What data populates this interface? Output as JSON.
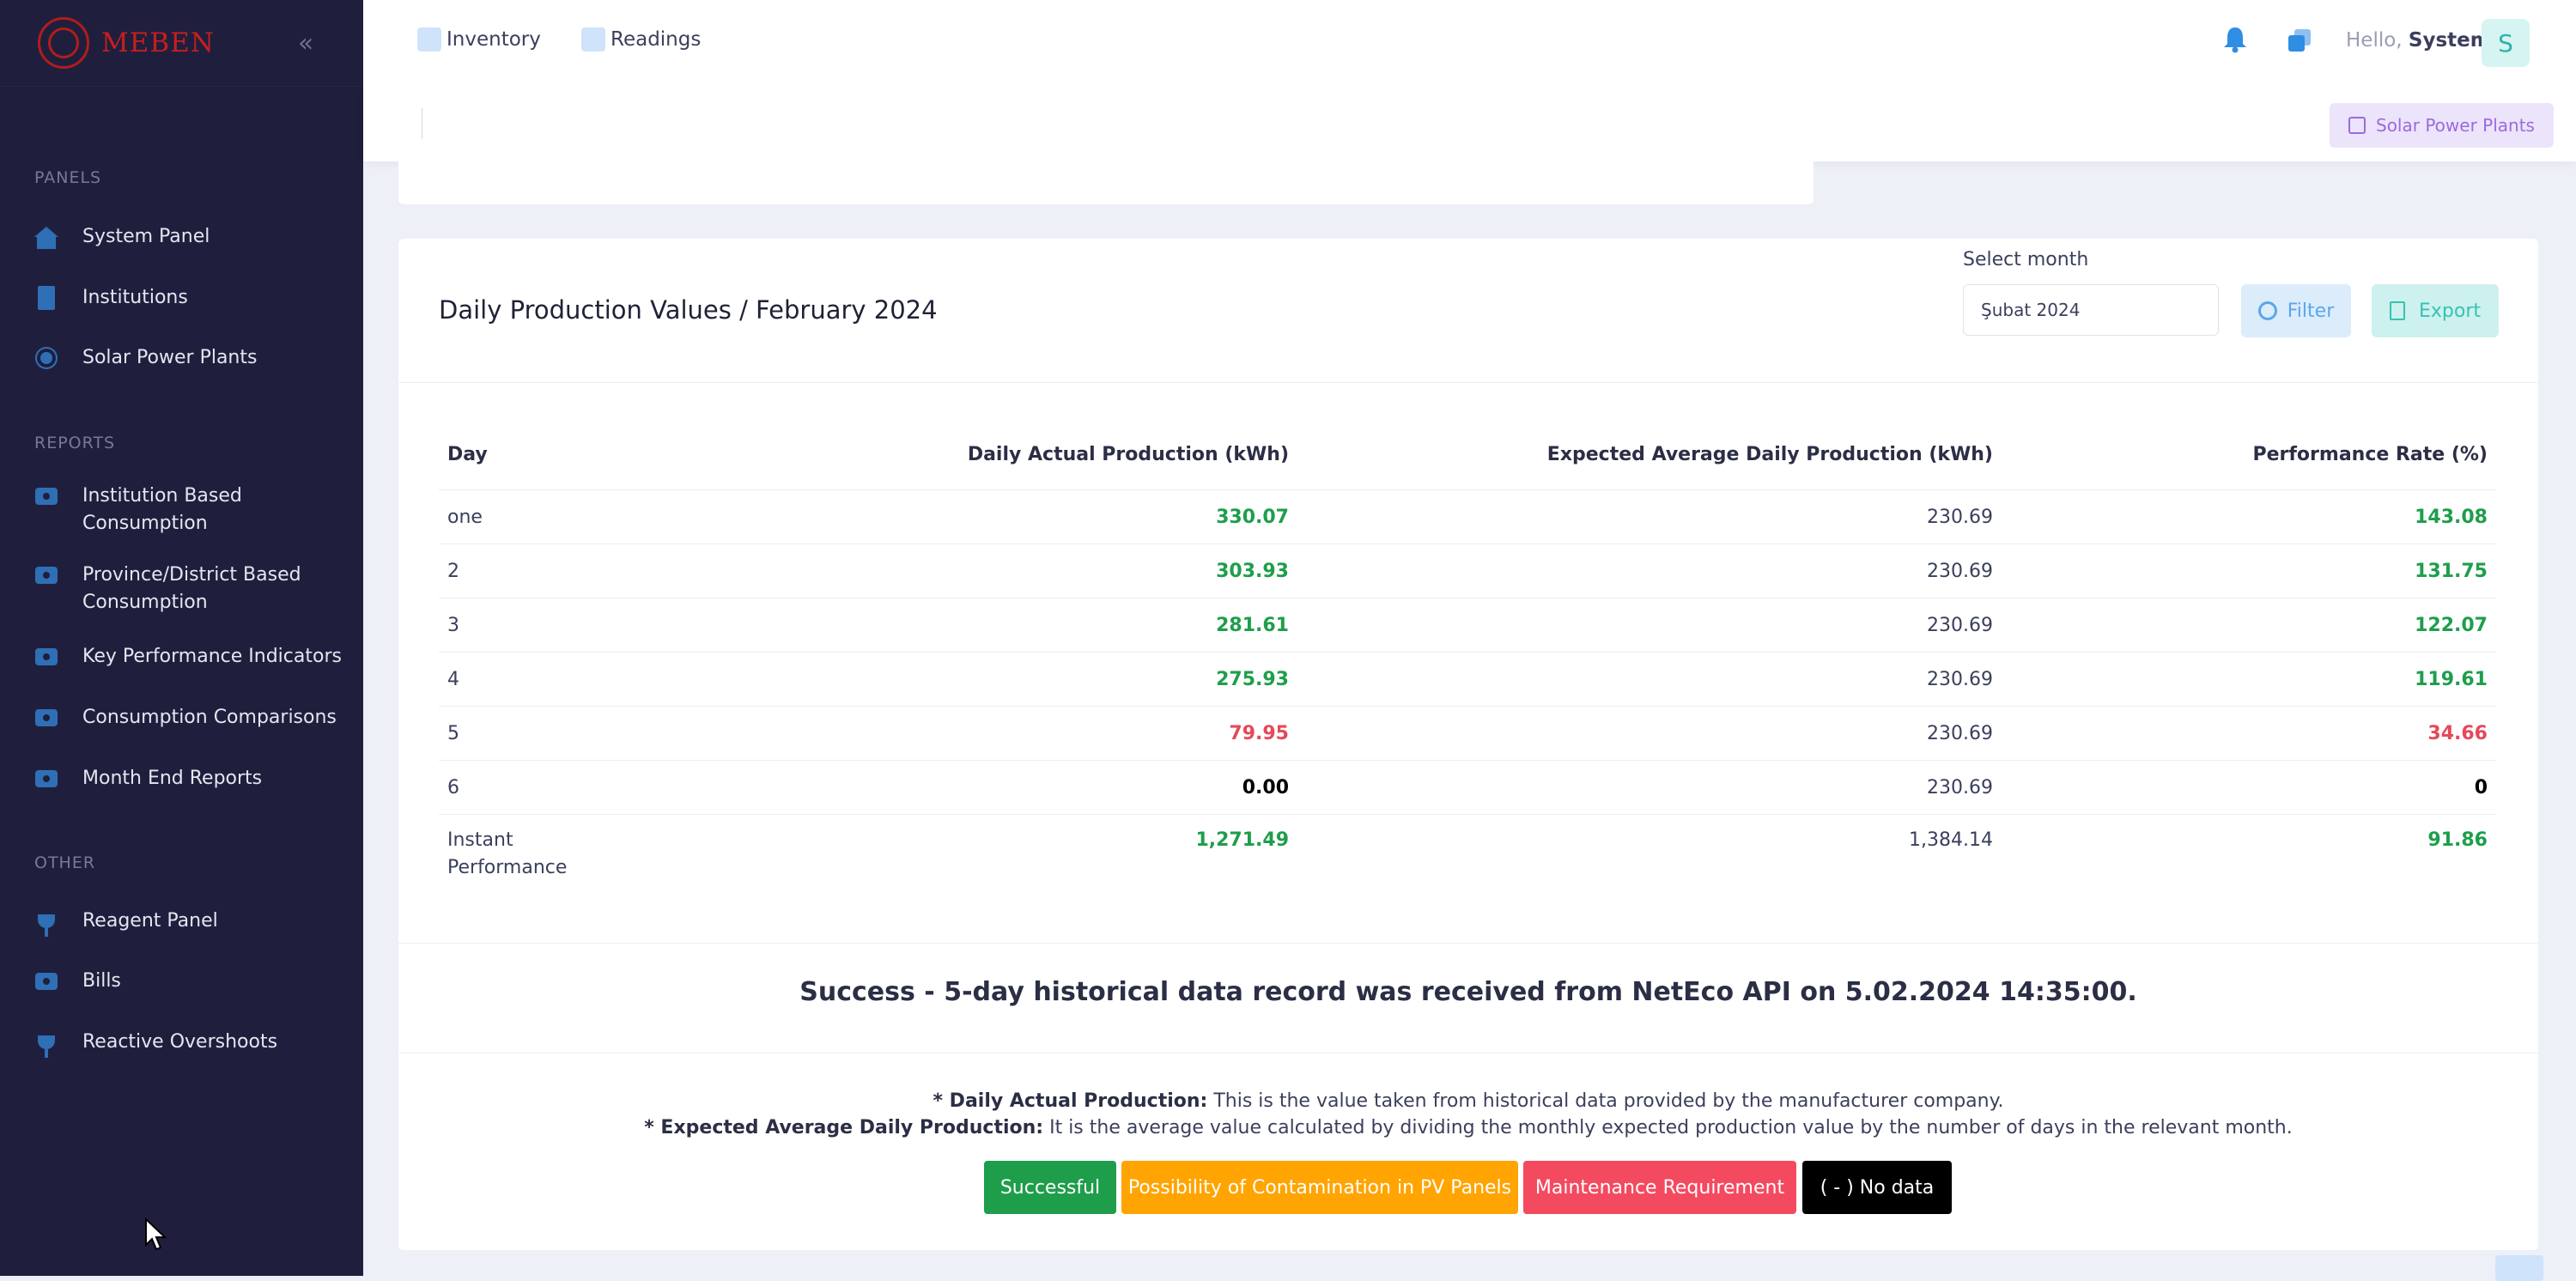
{
  "brand": {
    "name": "MEBEN"
  },
  "sidebar": {
    "sections": [
      {
        "title": "PANELS",
        "items": [
          {
            "label": "System Panel",
            "icon": "house-icon"
          },
          {
            "label": "Institutions",
            "icon": "building-icon"
          },
          {
            "label": "Solar Power Plants",
            "icon": "sun-icon"
          }
        ]
      },
      {
        "title": "REPORTS",
        "items": [
          {
            "label": "Institution Based Consumption",
            "icon": "report-icon"
          },
          {
            "label": "Province/District Based Consumption",
            "icon": "report-icon"
          },
          {
            "label": "Key Performance Indicators",
            "icon": "report-icon"
          },
          {
            "label": "Consumption Comparisons",
            "icon": "report-icon"
          },
          {
            "label": "Month End Reports",
            "icon": "report-icon"
          }
        ]
      },
      {
        "title": "OTHER",
        "items": [
          {
            "label": "Reagent Panel",
            "icon": "plug-icon"
          },
          {
            "label": "Bills",
            "icon": "report-icon"
          },
          {
            "label": "Reactive Overshoots",
            "icon": "plug-icon"
          }
        ]
      }
    ]
  },
  "topbar": {
    "links": [
      {
        "label": "Inventory"
      },
      {
        "label": "Readings"
      }
    ],
    "greeting": "Hello,",
    "user": "System",
    "avatar_letter": "S"
  },
  "subbar": {
    "button_label": "Solar Power Plants"
  },
  "card": {
    "title": "Daily Production Values / February 2024",
    "select_month_label": "Select month",
    "month_value": "Şubat 2024",
    "filter_label": "Filter",
    "export_label": "Export",
    "columns": [
      "Day",
      "Daily Actual Production (kWh)",
      "Expected Average Daily Production (kWh)",
      "Performance Rate (%)"
    ],
    "rows": [
      {
        "day": "one",
        "actual": "330.07",
        "expected": "230.69",
        "rate": "143.08",
        "status": "green"
      },
      {
        "day": "2",
        "actual": "303.93",
        "expected": "230.69",
        "rate": "131.75",
        "status": "green"
      },
      {
        "day": "3",
        "actual": "281.61",
        "expected": "230.69",
        "rate": "122.07",
        "status": "green"
      },
      {
        "day": "4",
        "actual": "275.93",
        "expected": "230.69",
        "rate": "119.61",
        "status": "green"
      },
      {
        "day": "5",
        "actual": "79.95",
        "expected": "230.69",
        "rate": "34.66",
        "status": "red"
      },
      {
        "day": "6",
        "actual": "0.00",
        "expected": "230.69",
        "rate": "0",
        "status": "black"
      }
    ],
    "total": {
      "day_line1": "Instant",
      "day_line2": "Performance",
      "actual": "1,271.49",
      "expected": "1,384.14",
      "rate": "91.86"
    },
    "success_message": "Success - 5-day historical data record was received from NetEco API on 5.02.2024 14:35:00.",
    "notes": [
      {
        "term": "* Daily Actual Production:",
        "text": " This is the value taken from historical data provided by the manufacturer company."
      },
      {
        "term": "* Expected Average Daily Production:",
        "text": " It is the average value calculated by dividing the monthly expected production value by the number of days in the relevant month."
      }
    ],
    "legend": [
      {
        "label": "Successful",
        "color": "#1e9e4b"
      },
      {
        "label": "Possibility of Contamination in PV Panels",
        "color": "#ffa400"
      },
      {
        "label": "Maintenance Requirement",
        "color": "#f44a60"
      },
      {
        "label": "( - ) No data",
        "color": "#000000"
      }
    ]
  }
}
